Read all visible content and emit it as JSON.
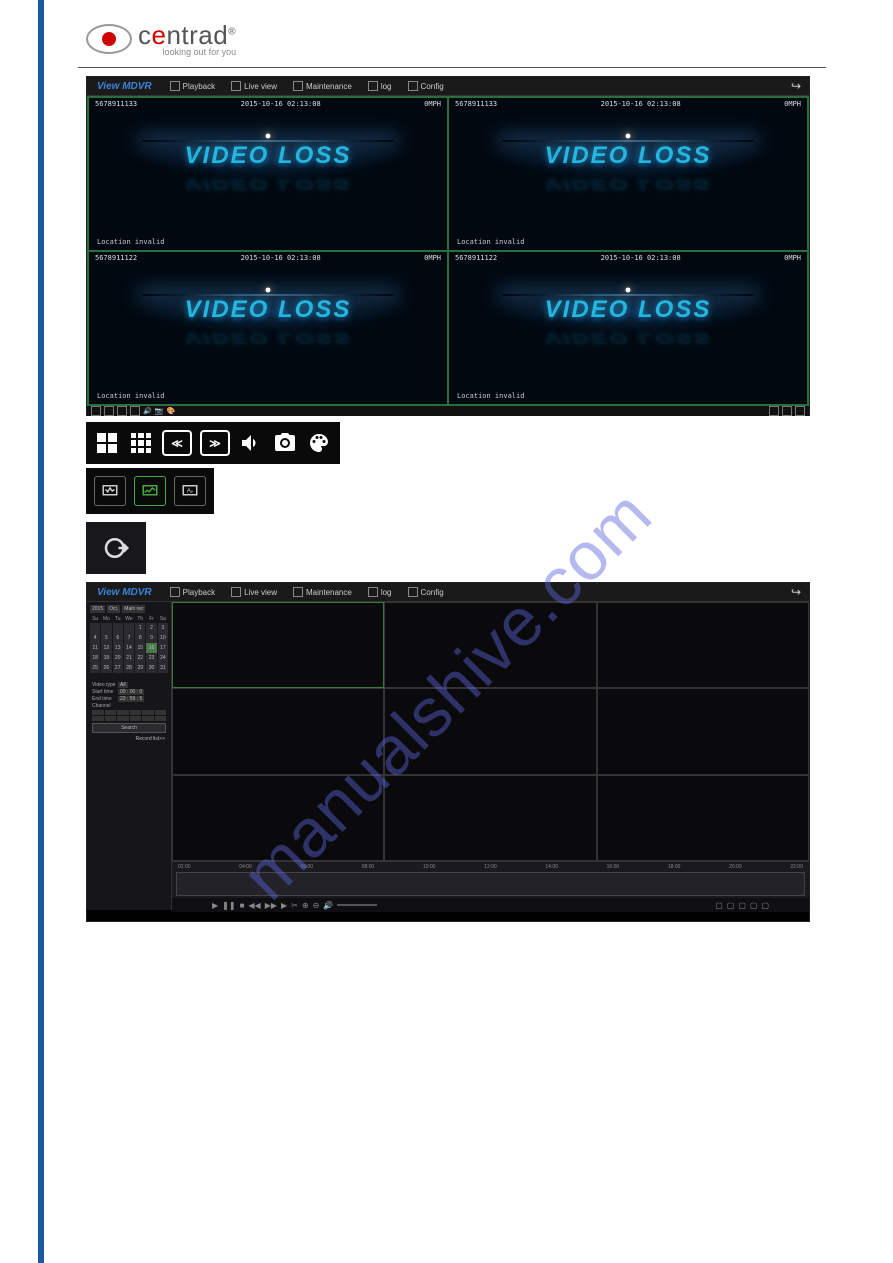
{
  "logo": {
    "name": "centrad",
    "tagline": "looking out for you"
  },
  "watermark": "manualshive.com",
  "app_brand": "View MDVR",
  "top_tabs": {
    "playback": "Playback",
    "liveview": "Live view",
    "maintenance": "Maintenance",
    "log": "log",
    "config": "Config"
  },
  "live": {
    "video_loss": "VIDEO LOSS",
    "location": "Location invalid",
    "cells": [
      {
        "id": "5678911133",
        "ts": "2015-10-16 02:13:08",
        "speed": "0MPH"
      },
      {
        "id": "5678911133",
        "ts": "2015-10-16 02:13:08",
        "speed": "0MPH"
      },
      {
        "id": "5678911122",
        "ts": "2015-10-16 02:13:08",
        "speed": "0MPH"
      },
      {
        "id": "5678911122",
        "ts": "2015-10-16 02:13:08",
        "speed": "0MPH"
      }
    ]
  },
  "playback": {
    "year": "2015",
    "month": "Oct.",
    "source": "Main rec",
    "weekdays": [
      "Su",
      "Mo",
      "Tu",
      "We",
      "Th",
      "Fr",
      "Sa"
    ],
    "weeks": [
      [
        "",
        "",
        "",
        "",
        "1",
        "2",
        "3"
      ],
      [
        "4",
        "5",
        "6",
        "7",
        "8",
        "9",
        "10"
      ],
      [
        "11",
        "12",
        "13",
        "14",
        "15",
        "16",
        "17"
      ],
      [
        "18",
        "19",
        "20",
        "21",
        "22",
        "23",
        "24"
      ],
      [
        "25",
        "26",
        "27",
        "28",
        "29",
        "30",
        "31"
      ]
    ],
    "selected_day": "16",
    "search": {
      "video_type_label": "Video type",
      "video_type": "All",
      "start_label": "Start time",
      "start": "00 : 00 : 0",
      "end_label": "End time",
      "end": "23 : 59 : 5",
      "channel_label": "Channel",
      "search_btn": "Search",
      "list_btn": "Record list>>"
    },
    "time_marks": [
      "02:00",
      "04:00",
      "06:00",
      "08:00",
      "10:00",
      "12:00",
      "14:00",
      "16:00",
      "18:00",
      "20:00",
      "22:00"
    ]
  }
}
